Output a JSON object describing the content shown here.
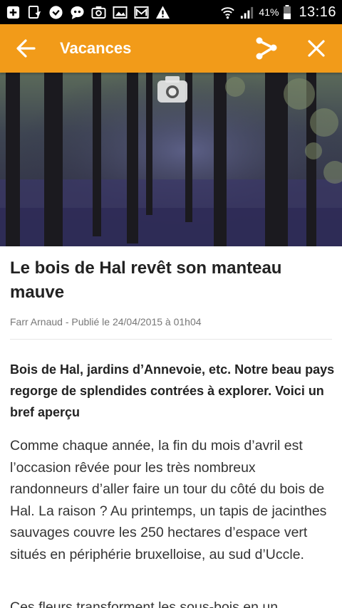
{
  "status_bar": {
    "battery_percent": "41%",
    "time": "13:16",
    "icons": [
      "add-box-icon",
      "download-icon",
      "check-circle-icon",
      "message-bubble-icon",
      "camera-icon",
      "image-icon",
      "mail-icon",
      "warning-icon",
      "wifi-icon",
      "signal-icon",
      "battery-icon"
    ]
  },
  "app_bar": {
    "title": "Vacances",
    "background": "#f29b19",
    "back_icon": "arrow-back-icon",
    "share_icon": "share-icon",
    "close_icon": "close-icon"
  },
  "article": {
    "image_icon": "camera-icon",
    "title": "Le bois de Hal revêt son manteau mauve",
    "byline": "Farr Arnaud - Publié le 24/04/2015 à 01h04",
    "lead": "Bois de Hal, jardins d’Annevoie, etc. Notre beau pays regorge de splendides contrées à explorer. Voici un bref aperçu",
    "body": "Comme chaque année, la fin du mois d’avril est l’occasion rêvée pour les très nombreux randonneurs d’aller faire un tour du côté du bois de Hal. La raison ? Au printemps, un tapis de jacinthes sauvages couvre les 250 hectares d’espace vert situés en périphérie bruxelloise, au sud d’Uccle.",
    "body_next": "Ces fleurs transforment les sous-bois en un"
  }
}
